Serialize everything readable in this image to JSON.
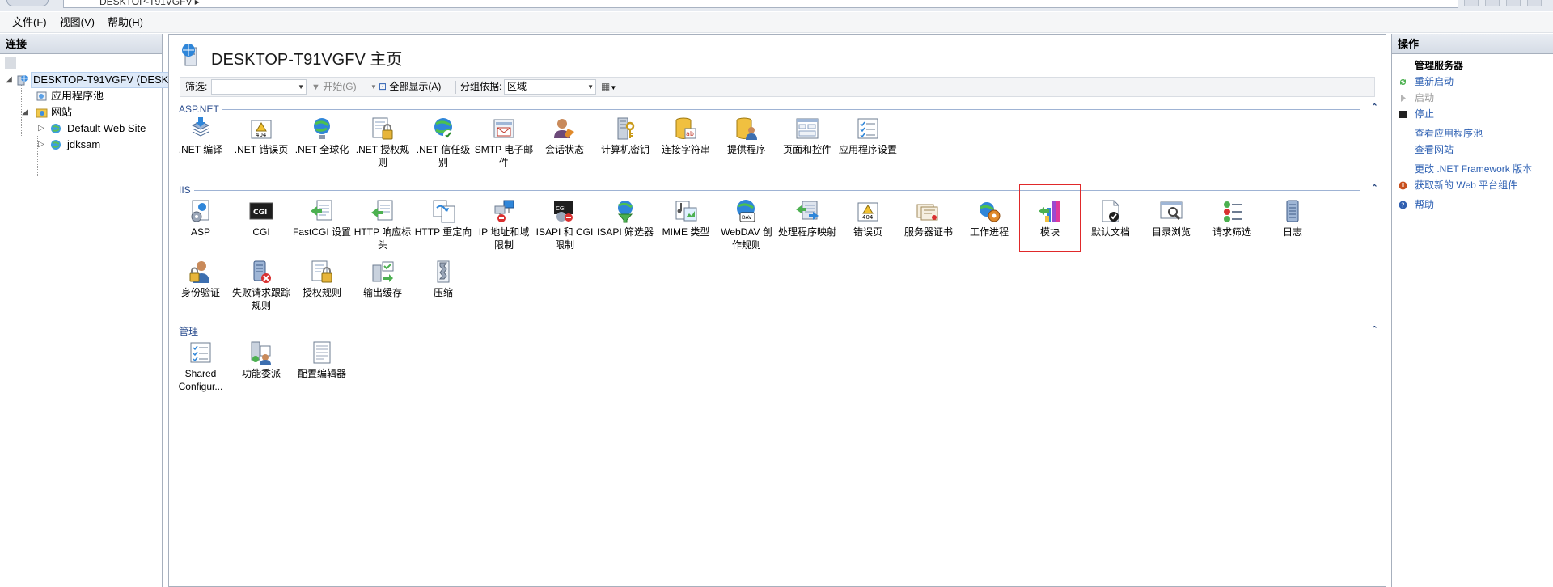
{
  "window": {
    "address_text": "DESKTOP-T91VGFV ▸"
  },
  "menu": [
    "文件(F)",
    "视图(V)",
    "帮助(H)"
  ],
  "left": {
    "title": "连接",
    "tree": {
      "server": "DESKTOP-T91VGFV (DESKTOP",
      "app_pools": "应用程序池",
      "sites": "网站",
      "site1": "Default Web Site",
      "site2": "jdksam"
    }
  },
  "main": {
    "title": "DESKTOP-T91VGFV 主页",
    "filter": {
      "label": "筛选:",
      "start": "开始(G)",
      "show_all": "全部显示(A)",
      "group_by": "分组依据:",
      "group_value": "区域"
    },
    "groups": {
      "aspnet": "ASP.NET",
      "iis": "IIS",
      "management": "管理"
    },
    "aspnet_items": [
      ".NET 编译",
      ".NET 错误页",
      ".NET 全球化",
      ".NET 授权规则",
      ".NET 信任级别",
      "SMTP 电子邮件",
      "会话状态",
      "计算机密钥",
      "连接字符串",
      "提供程序",
      "页面和控件",
      "应用程序设置"
    ],
    "iis_items": [
      "ASP",
      "CGI",
      "FastCGI 设置",
      "HTTP 响应标头",
      "HTTP 重定向",
      "IP 地址和域限制",
      "ISAPI 和 CGI 限制",
      "ISAPI 筛选器",
      "MIME 类型",
      "WebDAV 创作规则",
      "处理程序映射",
      "错误页",
      "服务器证书",
      "工作进程",
      "模块",
      "默认文档",
      "目录浏览",
      "请求筛选",
      "日志",
      "身份验证",
      "失败请求跟踪规则",
      "授权规则",
      "输出缓存",
      "压缩"
    ],
    "management_items": [
      "Shared Configur...",
      "功能委派",
      "配置编辑器"
    ]
  },
  "right": {
    "title": "操作",
    "manage_server": "管理服务器",
    "restart": "重新启动",
    "start": "启动",
    "stop": "停止",
    "view_pools": "查看应用程序池",
    "view_sites": "查看网站",
    "change_net": "更改 .NET Framework 版本",
    "get_web_components": "获取新的 Web 平台组件",
    "help": "帮助"
  },
  "colors": {
    "link": "#2c5fb2",
    "group_header": "#2b4d8e",
    "highlight_box": "#e0292a"
  }
}
